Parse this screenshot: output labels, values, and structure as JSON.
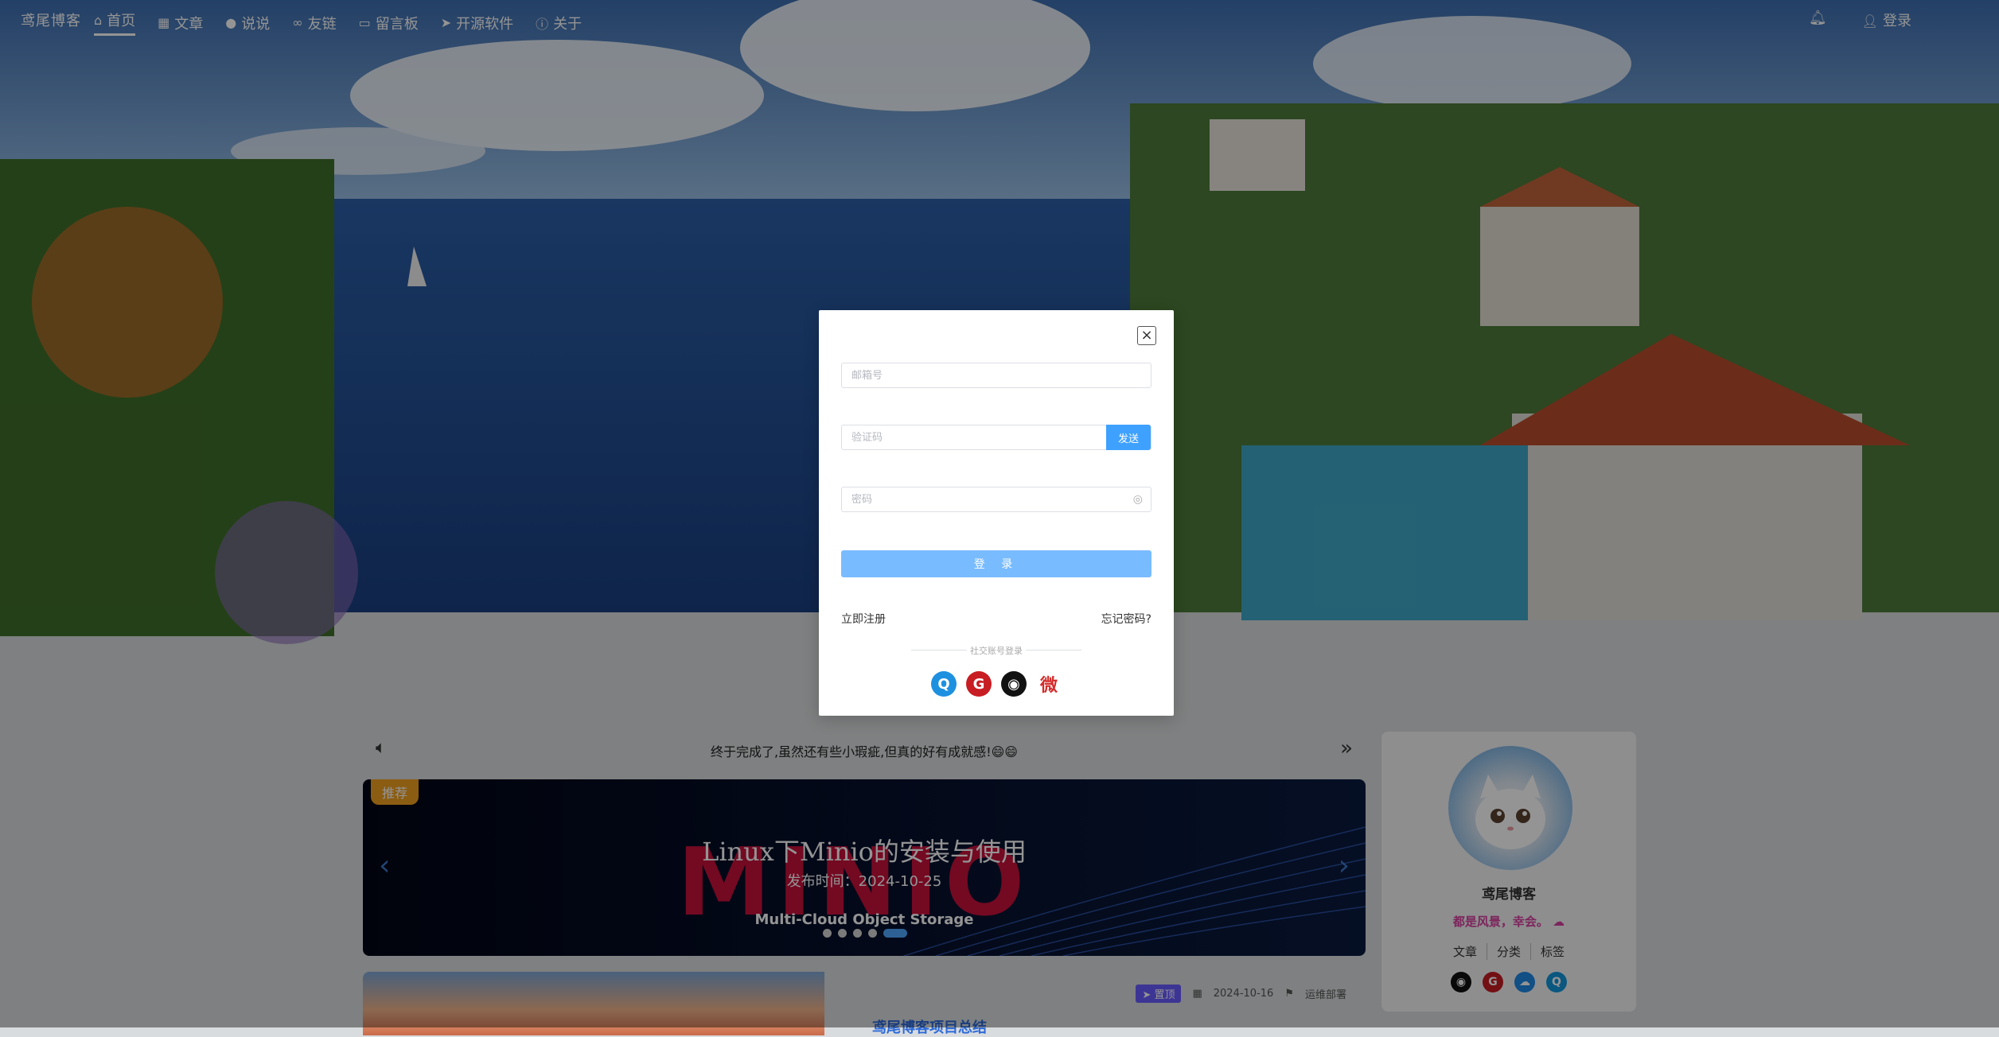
{
  "nav": {
    "brand": "鸢尾博客",
    "items": [
      {
        "icon": "home-icon",
        "label": "首页",
        "active": true
      },
      {
        "icon": "grid-icon",
        "label": "文章"
      },
      {
        "icon": "chat-icon",
        "label": "说说"
      },
      {
        "icon": "link-icon",
        "label": "友链"
      },
      {
        "icon": "message-board-icon",
        "label": "留言板"
      },
      {
        "icon": "send-icon",
        "label": "开源软件"
      },
      {
        "icon": "info-icon",
        "label": "关于"
      }
    ],
    "right": {
      "bell_icon": "bell-icon",
      "login_label": "登录"
    }
  },
  "announcement": {
    "text": "终于完成了,虽然还有些小瑕疵,但真的好有成就感!😄😄"
  },
  "carousel": {
    "badge": "推荐",
    "title": "Linux下Minio的安装与使用",
    "date": "发布时间：2024-10-25",
    "logo_text": "MINIO",
    "caption": "Multi-Cloud Object Storage",
    "slides": 5,
    "active_slide": 5
  },
  "post": {
    "tag": "置顶",
    "date": "2024-10-16",
    "category": "运维部署",
    "title": "鸢尾博客项目总结"
  },
  "profile": {
    "name": "鸢尾博客",
    "motto": "都是风景，幸会。",
    "links": [
      "文章",
      "分类",
      "标签"
    ]
  },
  "modal": {
    "email_placeholder": "邮箱号",
    "code_placeholder": "验证码",
    "send_label": "发送",
    "password_placeholder": "密码",
    "login_label": "登 录",
    "register_label": "立即注册",
    "forgot_label": "忘记密码?",
    "social_label": "社交账号登录",
    "socials": [
      "qq-icon",
      "gitee-icon",
      "github-icon",
      "weibo-icon"
    ]
  },
  "colors": {
    "primary": "#3fa1ff",
    "login_button": "#79bbff",
    "badge": "#f0a020",
    "motto": "#d6409f"
  }
}
